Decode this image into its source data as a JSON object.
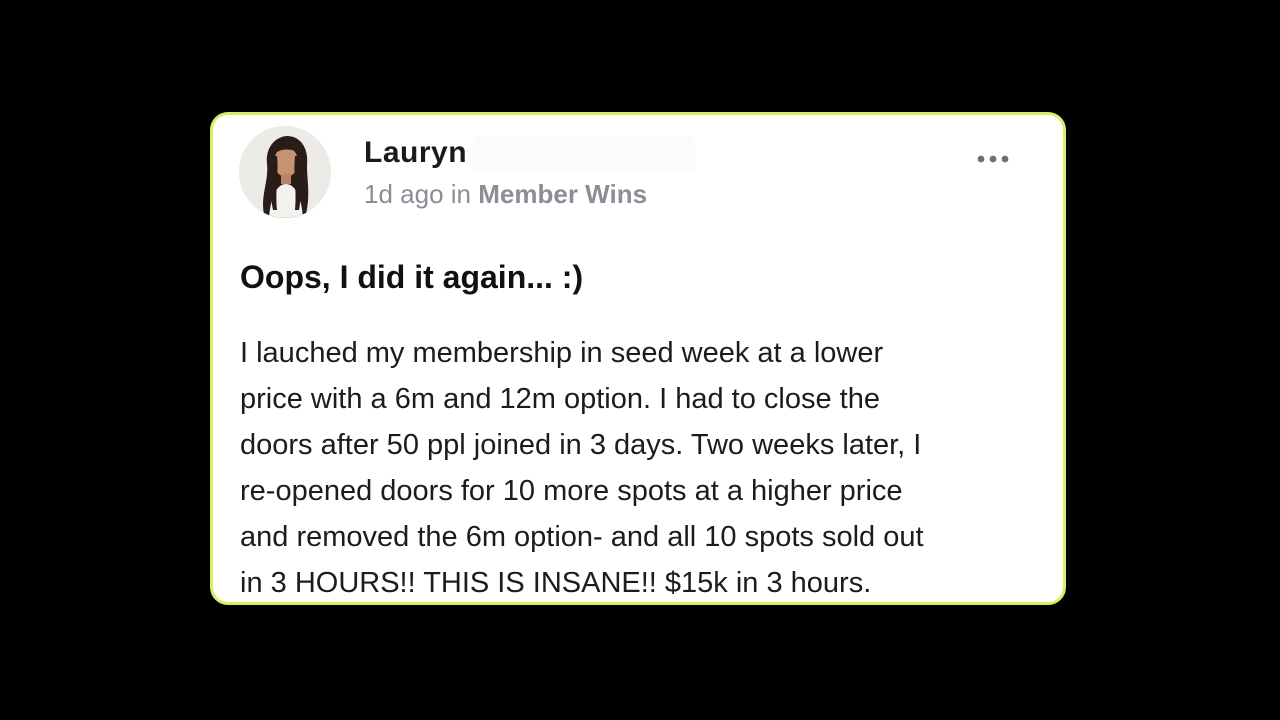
{
  "post": {
    "author": {
      "name": "Lauryn",
      "avatar": "profile-photo"
    },
    "meta": {
      "time": "1d ago",
      "in_word": "in",
      "category": "Member Wins"
    },
    "menu_icon": "more-horizontal-icon",
    "title": "Oops, I did it again... :)",
    "body_lines": [
      "I lauched my membership in seed week at a lower",
      "price with a 6m and 12m option. I had to close the",
      "doors after 50 ppl joined in 3 days. Two weeks later, I",
      "re-opened doors for 10 more spots at a higher price",
      "and removed the 6m option- and all 10 spots sold out",
      "in 3 HOURS!! THIS IS INSANE!! $15k in 3 hours."
    ]
  },
  "colors": {
    "background": "#000000",
    "card": "#ffffff",
    "card_border": "#d7ef66",
    "meta_text": "#8a8e96"
  }
}
